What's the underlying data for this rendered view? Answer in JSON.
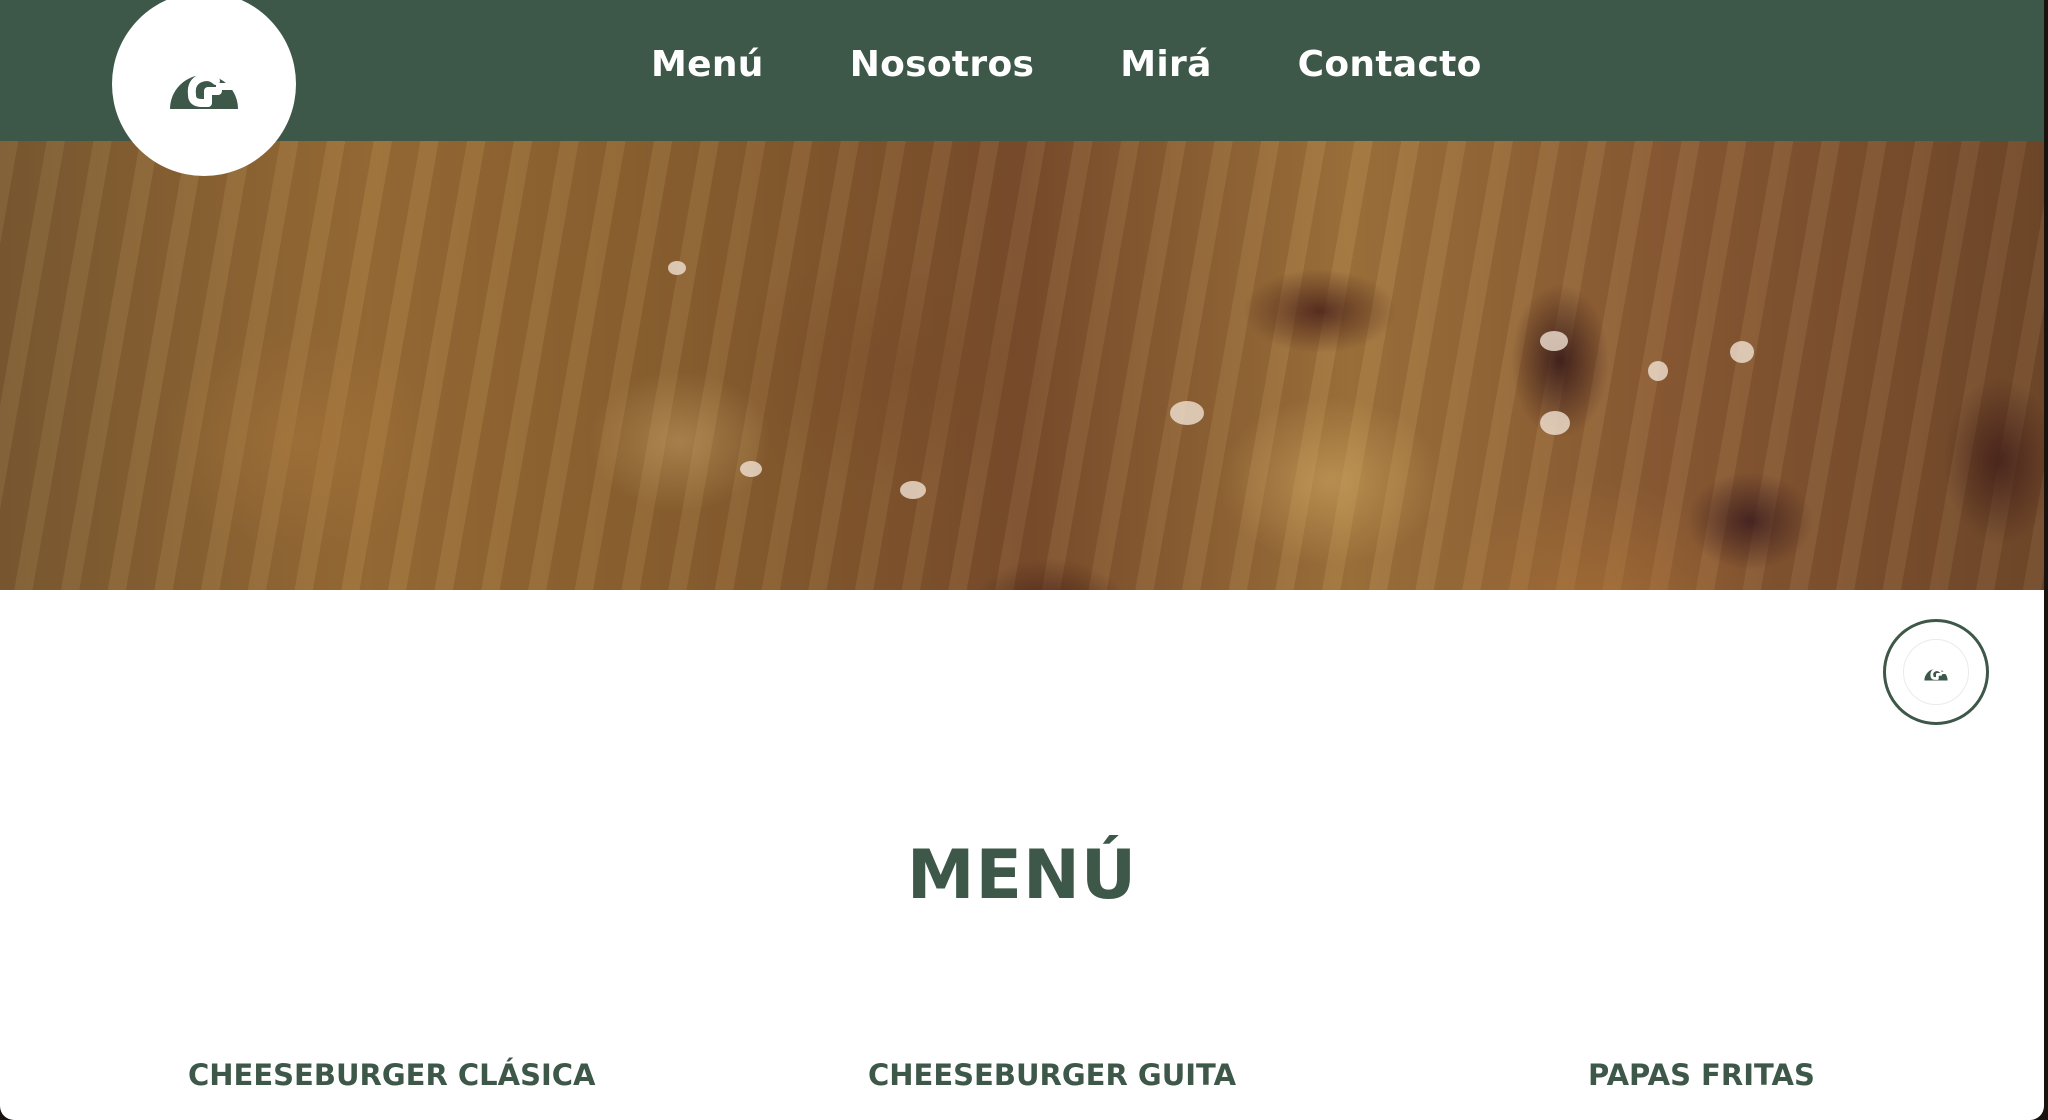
{
  "nav": {
    "logo_icon": "guita-g-logo-icon",
    "links": [
      "Menú",
      "Nosotros",
      "Mirá",
      "Contacto"
    ]
  },
  "hero": {
    "image": "food-closeup-hero-image"
  },
  "badge": {
    "icon": "guita-g-logo-icon"
  },
  "menu": {
    "title": "MENÚ",
    "items": [
      {
        "name": "CHEESEBURGER CLÁSICA"
      },
      {
        "name": "CHEESEBURGER GUITA"
      },
      {
        "name": "PAPAS FRITAS"
      }
    ]
  },
  "colors": {
    "brand_green": "#3d5748",
    "background": "#ffffff",
    "nav_text": "#ffffff"
  }
}
